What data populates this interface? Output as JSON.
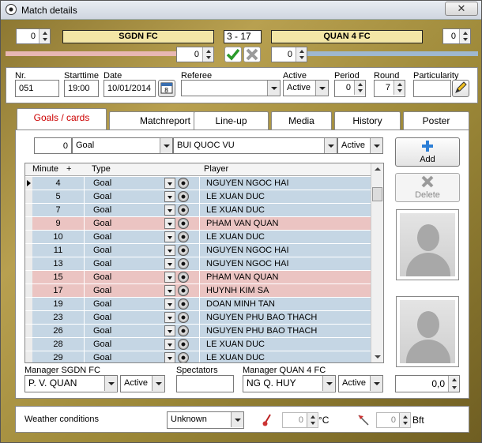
{
  "window": {
    "title": "Match details",
    "close": "✕"
  },
  "score_header": {
    "home_left_value": "0",
    "home_team": "SGDN FC",
    "score": "3  - 17",
    "away_team": "QUAN 4 FC",
    "away_right_value": "0",
    "home_extra_value": "0",
    "away_extra_value": "0",
    "home_color": "#e8b7b3",
    "away_color": "#9fb8cf"
  },
  "details": {
    "nr_label": "Nr.",
    "nr_value": "051",
    "starttime_label": "Starttime",
    "starttime_value": "19:00",
    "date_label": "Date",
    "date_value": "10/01/2014",
    "referee_label": "Referee",
    "referee_value": "",
    "active_label": "Active",
    "active_value": "Active",
    "period_label": "Period",
    "period_value": "0",
    "round_label": "Round",
    "round_value": "7",
    "particularity_label": "Particularity",
    "particularity_value": ""
  },
  "tabs": [
    {
      "label": "Goals / cards",
      "active": true
    },
    {
      "label": "Matchreport"
    },
    {
      "label": "Line-up"
    },
    {
      "label": "Media"
    },
    {
      "label": "History"
    },
    {
      "label": "Poster"
    }
  ],
  "entry": {
    "minute": "0",
    "type": "Goal",
    "player": "BUI QUOC VU",
    "status": "Active",
    "add_label": "Add",
    "delete_label": "Delete"
  },
  "grid": {
    "col_minute": "Minute",
    "col_plus": "+",
    "col_type": "Type",
    "col_player": "Player",
    "rows": [
      {
        "minute": "4",
        "type": "Goal",
        "player": "NGUYEN NGOC HAI",
        "team": "away"
      },
      {
        "minute": "5",
        "type": "Goal",
        "player": "LE XUAN DUC",
        "team": "away"
      },
      {
        "minute": "7",
        "type": "Goal",
        "player": "LE XUAN DUC",
        "team": "away"
      },
      {
        "minute": "9",
        "type": "Goal",
        "player": "PHAM VAN QUAN",
        "team": "home"
      },
      {
        "minute": "10",
        "type": "Goal",
        "player": "LE XUAN DUC",
        "team": "away"
      },
      {
        "minute": "11",
        "type": "Goal",
        "player": "NGUYEN NGOC HAI",
        "team": "away"
      },
      {
        "minute": "13",
        "type": "Goal",
        "player": "NGUYEN NGOC HAI",
        "team": "away"
      },
      {
        "minute": "15",
        "type": "Goal",
        "player": "PHAM VAN QUAN",
        "team": "home"
      },
      {
        "minute": "17",
        "type": "Goal",
        "player": "HUYNH KIM SA",
        "team": "home"
      },
      {
        "minute": "19",
        "type": "Goal",
        "player": "DOAN MINH TAN",
        "team": "away"
      },
      {
        "minute": "23",
        "type": "Goal",
        "player": "NGUYEN PHU BAO THACH",
        "team": "away"
      },
      {
        "minute": "26",
        "type": "Goal",
        "player": "NGUYEN PHU BAO THACH",
        "team": "away"
      },
      {
        "minute": "28",
        "type": "Goal",
        "player": "LE XUAN DUC",
        "team": "away"
      },
      {
        "minute": "29",
        "type": "Goal",
        "player": "LE XUAN DUC",
        "team": "away"
      }
    ]
  },
  "managers": {
    "home_label": "Manager SGDN FC",
    "home_value": "P. V. QUAN",
    "home_status": "Active",
    "spectators_label": "Spectators",
    "spectators_value": "",
    "away_label": "Manager QUAN 4 FC",
    "away_value": "NG Q. HUY",
    "away_status": "Active",
    "rating_value": "0,0"
  },
  "weather": {
    "label": "Weather conditions",
    "value": "Unknown",
    "temp_value": "0",
    "temp_unit": "°C",
    "wind_value": "0",
    "wind_unit": "Bft"
  }
}
